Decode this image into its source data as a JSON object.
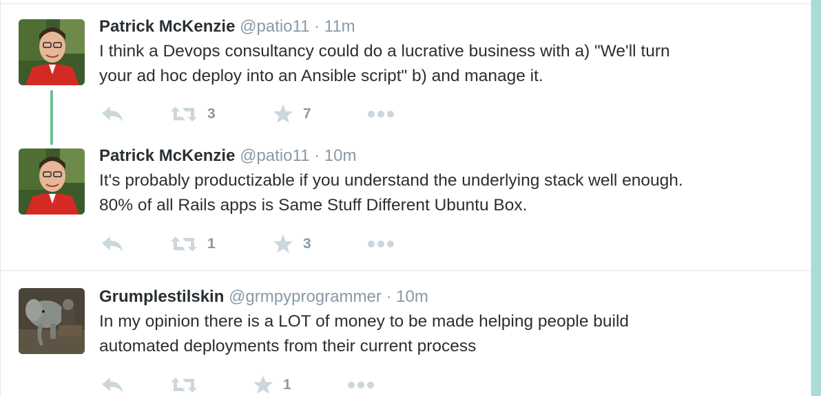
{
  "tweets": [
    {
      "name": "Patrick McKenzie",
      "handle": "@patio11",
      "separator": "·",
      "time": "11m",
      "text_lines": [
        "I think a Devops consultancy could do a lucrative business with a) \"We'll turn",
        "your ad hoc deploy into an Ansible script\" b) and manage it."
      ],
      "retweets": "3",
      "favorites": "7"
    },
    {
      "name": "Patrick McKenzie",
      "handle": "@patio11",
      "separator": "·",
      "time": "10m",
      "text_lines": [
        "It's probably productizable if you understand the underlying stack well enough.",
        "80% of all Rails apps is Same Stuff Different Ubuntu Box."
      ],
      "retweets": "1",
      "favorites": "3"
    },
    {
      "name": "Grumplestilskin",
      "handle": "@grmpyprogrammer",
      "separator": "·",
      "time": "10m",
      "text_lines": [
        "In my opinion there is a LOT of money to be made helping people build",
        "automated deployments from their current process"
      ],
      "retweets": "",
      "favorites": "1"
    }
  ],
  "icons": {
    "reply": "reply-icon",
    "retweet": "retweet-icon",
    "favorite": "star-icon",
    "more": "more-icon"
  },
  "colors": {
    "text": "#292f33",
    "muted": "#8899a6",
    "icon": "#ccd6dd",
    "thread_line": "#6cc197",
    "accent_strip": "#a8dcd5"
  }
}
